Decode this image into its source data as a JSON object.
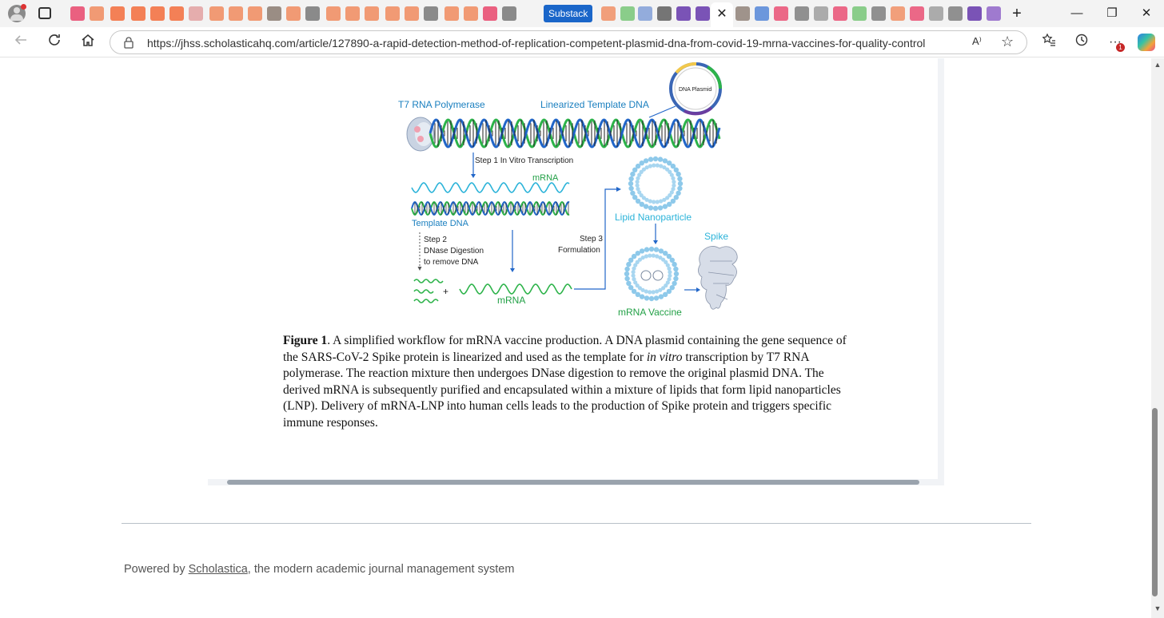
{
  "browser": {
    "substack_tab_label": "Substack",
    "close_glyph": "✕",
    "new_tab_glyph": "+",
    "window_controls": {
      "minimize": "—",
      "restore": "❐",
      "close": "✕"
    },
    "url": "https://jhss.scholasticahq.com/article/127890-a-rapid-detection-method-of-replication-competent-plasmid-dna-from-covid-19-mrna-vaccines-for-quality-control",
    "read_aloud_glyph": "A⁾",
    "favorite_glyph": "☆",
    "notification_count": "1",
    "tab_icon_colors": [
      "#e8456b",
      "#f08a5d",
      "#f26b3a",
      "#f26b3a",
      "#f26b3a",
      "#f26b3a",
      "#e2a0a0",
      "#f08a5d",
      "#f08a5d",
      "#f08a5d",
      "#8a7a70",
      "#f08a5d",
      "#777",
      "#f08a5d",
      "#f08a5d",
      "#f08a5d",
      "#f08a5d",
      "#f08a5d",
      "#777",
      "#f08a5d",
      "#f08a5d",
      "#e8456b",
      "#777"
    ]
  },
  "figure": {
    "t7_label": "T7 RNA Polymerase",
    "linearized_label": "Linearized Template DNA",
    "plasmid_label": "DNA Plasmid",
    "step1_label": "Step 1  In Vitro Transcription",
    "mrna_top_label": "mRNA",
    "template_dna_label": "Template DNA",
    "step2_line1": "Step 2",
    "step2_line2": "DNase Digestion",
    "step2_line3": "to remove DNA",
    "step3_line1": "Step 3",
    "step3_line2": "Formulation",
    "lnp_label": "Lipid Nanoparticle",
    "spike_label": "Spike",
    "plus_sign": "+",
    "mrna_bottom_label": "mRNA",
    "vaccine_label": "mRNA Vaccine",
    "colors": {
      "blue_text": "#1a7fbf",
      "green_text": "#22a046",
      "dna_green": "#2db34a",
      "dna_blue": "#2166c9",
      "mrna": "#2bb3d9",
      "lipid": "#8ec9ea"
    }
  },
  "caption": {
    "lead": "Figure 1",
    "part1": ". A simplified workflow for mRNA vaccine production. A DNA plasmid containing the gene sequence of the SARS-CoV-2 Spike protein is linearized and used as the template for ",
    "italic": "in vitro",
    "part2": " transcription by T7 RNA polymerase. The reaction mixture then undergoes DNase digestion to remove the original plasmid DNA. The derived mRNA is subsequently purified and encapsulated within a mixture of lipids that form lipid nanoparticles (LNP). Delivery of mRNA-LNP into human cells leads to the production of Spike protein and triggers specific immune responses."
  },
  "footer": {
    "prefix": "Powered by ",
    "link": "Scholastica",
    "suffix": ", the modern academic journal management system"
  }
}
